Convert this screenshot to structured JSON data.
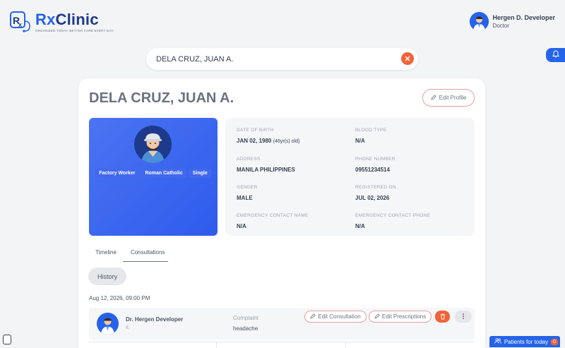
{
  "app": {
    "name_prefix": "Rx",
    "name_suffix": "Clinic",
    "tagline": "ORGANIZED TODAY. BETTER CARE EVERY DAY."
  },
  "user": {
    "name": "Hergen D. Developer",
    "role": "Doctor"
  },
  "search": {
    "value": "DELA CRUZ, JUAN A."
  },
  "patient": {
    "name": "DELA CRUZ, JUAN A.",
    "edit_label": "Edit Profile",
    "tags": [
      "Factory Worker",
      "Roman Catholic",
      "Single"
    ],
    "details": {
      "dob_label": "DATE OF BIRTH",
      "dob_value": "JAN 02, 1980",
      "dob_age": "(46yr(s) old)",
      "blood_label": "BLOOD TYPE",
      "blood_value": "N/A",
      "address_label": "ADDRESS",
      "address_value": "MANILA PHILIPPINES",
      "phone_label": "PHONE NUMBER",
      "phone_value": "09551234514",
      "gender_label": "GENDER",
      "gender_value": "MALE",
      "registered_label": "REGISTERED ON",
      "registered_value": "JUL 02, 2026",
      "ec_name_label": "EMERGENCY CONTACT NAME",
      "ec_name_value": "N/A",
      "ec_phone_label": "EMERGENCY CONTACT PHONE",
      "ec_phone_value": "N/A"
    }
  },
  "tabs": [
    {
      "label": "Timeline"
    },
    {
      "label": "Consultations"
    }
  ],
  "history_label": "History",
  "consultation": {
    "date": "Aug 12, 2026, 09:00 PM",
    "doctor_name": "Dr. Hergen Developer",
    "doctor_spec": "It",
    "complaint_label": "Complaint",
    "complaint_value": "headache",
    "edit_consultation_label": "Edit Consultation",
    "edit_prescriptions_label": "Edit Prescriptions"
  },
  "patients_today": {
    "label": "Patients for today",
    "count": "0"
  },
  "colors": {
    "primary": "#2563eb",
    "danger": "#f16339",
    "outline": "#e5a09f"
  }
}
